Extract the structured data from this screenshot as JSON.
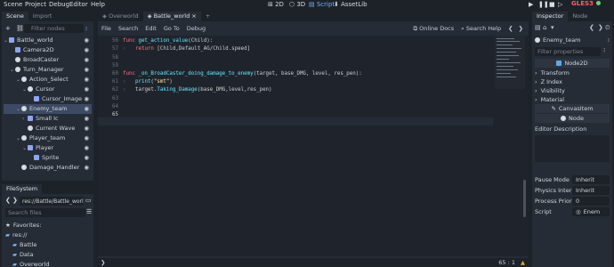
{
  "menu": [
    "Scene",
    "Project",
    "Debug",
    "Editor",
    "Help"
  ],
  "workspaces": [
    {
      "label": "2D",
      "active": false
    },
    {
      "label": "3D",
      "active": false
    },
    {
      "label": "Script",
      "active": true
    },
    {
      "label": "AssetLib",
      "active": false
    }
  ],
  "renderer": "GLES3",
  "scene_dock": {
    "tabs": [
      "Scene",
      "Import"
    ],
    "filter_placeholder": "Filter nodes",
    "nodes": [
      {
        "label": "Battle_world",
        "indent": 0,
        "caret": "v",
        "icon": "g",
        "selected": false
      },
      {
        "label": "Camera2D",
        "indent": 1,
        "caret": "",
        "icon": "g",
        "selected": false
      },
      {
        "label": "BroadCaster",
        "indent": 1,
        "caret": "",
        "icon": "w",
        "selected": false
      },
      {
        "label": "Turn_Manager",
        "indent": 1,
        "caret": "v",
        "icon": "w",
        "selected": false
      },
      {
        "label": "Action_Select",
        "indent": 2,
        "caret": "v",
        "icon": "w",
        "selected": false
      },
      {
        "label": "Cursor",
        "indent": 3,
        "caret": "v",
        "icon": "w",
        "selected": false
      },
      {
        "label": "Cursor_Image",
        "indent": 4,
        "caret": "",
        "icon": "g",
        "selected": false
      },
      {
        "label": "Enemy_team",
        "indent": 2,
        "caret": "v",
        "icon": "w",
        "selected": true
      },
      {
        "label": "Small Ic",
        "indent": 3,
        "caret": ">",
        "icon": "g",
        "selected": false
      },
      {
        "label": "Current Wave",
        "indent": 3,
        "caret": "",
        "icon": "w",
        "selected": false
      },
      {
        "label": "Player_team",
        "indent": 2,
        "caret": "v",
        "icon": "w",
        "selected": false
      },
      {
        "label": "Player",
        "indent": 3,
        "caret": "v",
        "icon": "g",
        "selected": false
      },
      {
        "label": "Sprite",
        "indent": 4,
        "caret": "",
        "icon": "g",
        "selected": false
      },
      {
        "label": "Damage_Handler",
        "indent": 2,
        "caret": "",
        "icon": "w",
        "selected": false
      }
    ]
  },
  "filesystem": {
    "title": "FileSystem",
    "path": "res://Battle/Battle_world",
    "search_placeholder": "Search files",
    "items": [
      {
        "label": "Favorites:",
        "indent": 0,
        "icon": "star"
      },
      {
        "label": "res://",
        "indent": 0,
        "icon": "folder"
      },
      {
        "label": "Battle",
        "indent": 1,
        "icon": "folder"
      },
      {
        "label": "Data",
        "indent": 1,
        "icon": "folder"
      },
      {
        "label": "Overworld",
        "indent": 1,
        "icon": "folder"
      }
    ]
  },
  "editor": {
    "tabs": [
      "Overworld",
      "Battle_world"
    ],
    "active_tab": "Battle_world",
    "menu": [
      "File",
      "Search",
      "Edit",
      "Go To",
      "Debug"
    ],
    "online_docs": "Online Docs",
    "search_help": "Search Help",
    "status": "65 :   1",
    "lines": [
      {
        "n": "56",
        "parts": [
          [
            "kw",
            "func "
          ],
          [
            "fn",
            "get_action_value"
          ],
          [
            "tx",
            "(Child):"
          ]
        ]
      },
      {
        "n": "57",
        "parts": [
          [
            "gut",
            "»   "
          ],
          [
            "kw",
            "return "
          ],
          [
            "tx",
            "[Child,Default_AG/Child.speed]"
          ]
        ]
      },
      {
        "n": "58",
        "parts": []
      },
      {
        "n": "59",
        "parts": []
      },
      {
        "n": "60",
        "parts": [
          [
            "kw",
            "func "
          ],
          [
            "fn",
            "_on_BroadCaster_doing_damage_to_enemy"
          ],
          [
            "tx",
            "(target, base_DMG, level, res_pen):"
          ]
        ]
      },
      {
        "n": "61",
        "parts": [
          [
            "gut",
            "»   "
          ],
          [
            "fn",
            "print"
          ],
          [
            "tx",
            "("
          ],
          [
            "st",
            "\"smt\""
          ],
          [
            "tx",
            ")"
          ]
        ]
      },
      {
        "n": "62",
        "parts": [
          [
            "gut",
            "»   "
          ],
          [
            "tx",
            "target."
          ],
          [
            "fn",
            "Taking_Damage"
          ],
          [
            "tx",
            "(base_DMG,level,res_pen)"
          ]
        ]
      },
      {
        "n": "63",
        "parts": []
      },
      {
        "n": "64",
        "parts": []
      },
      {
        "n": "65",
        "parts": []
      }
    ]
  },
  "inspector": {
    "tabs": [
      "Inspector",
      "Node"
    ],
    "node_name": "Enemy_team",
    "filter_placeholder": "Filter properties",
    "class_header": "Node2D",
    "sections": [
      "Transform",
      "Z Index",
      "Visibility",
      "Material"
    ],
    "canvas_item": "CanvasItem",
    "node_header": "Node",
    "editor_description": "Editor Description",
    "props": [
      {
        "label": "Pause Mode",
        "value": "Inherit"
      },
      {
        "label": "Physics Interp",
        "value": "Inherit"
      },
      {
        "label": "Process Priori",
        "value": "0"
      },
      {
        "label": "Script",
        "value": "Enem"
      }
    ]
  }
}
